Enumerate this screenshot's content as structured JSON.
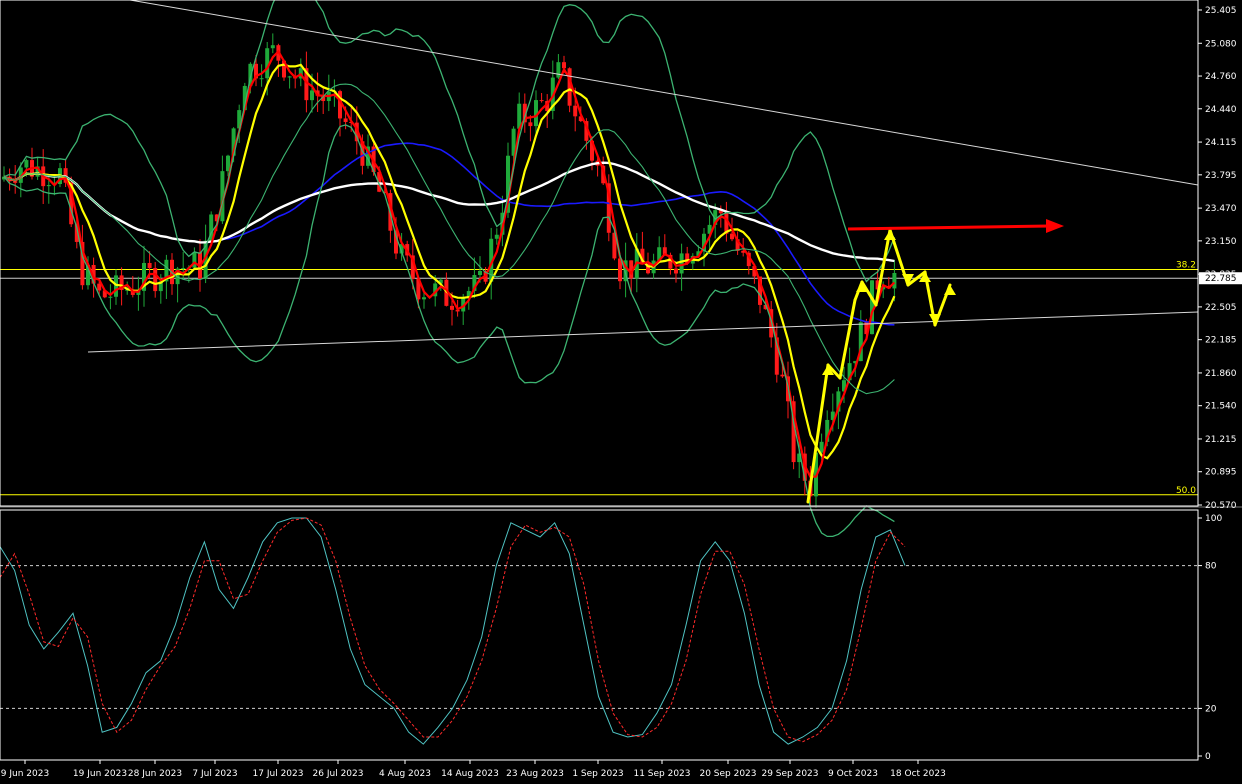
{
  "chart_data": [
    {
      "type": "candlestick",
      "title": "",
      "ylim": [
        20.57,
        25.405
      ],
      "y_ticks": [
        "25.405",
        "25.080",
        "24.760",
        "24.440",
        "24.115",
        "23.795",
        "23.470",
        "23.150",
        "22.825",
        "22.505",
        "22.185",
        "21.860",
        "21.540",
        "21.215",
        "20.895",
        "20.570"
      ],
      "x_ticks": [
        "9 Jun 2023",
        "19 Jun 2023",
        "28 Jun 2023",
        "7 Jul 2023",
        "17 Jul 2023",
        "26 Jul 2023",
        "4 Aug 2023",
        "14 Aug 2023",
        "23 Aug 2023",
        "1 Sep 2023",
        "11 Sep 2023",
        "20 Sep 2023",
        "29 Sep 2023",
        "9 Oct 2023",
        "18 Oct 2023"
      ],
      "current_price": "22.785",
      "fibonacci_levels": [
        {
          "label": "38.2",
          "value": 22.87
        },
        {
          "label": "50.0",
          "value": 20.67
        }
      ],
      "colors": {
        "bull_candle": "#1faa3a",
        "bear_candle": "#ff1a1a",
        "fast_ma": "#ff0000",
        "slow_ma": "#ffff00",
        "ma_blue": "#1a1aff",
        "ma_white": "#ffffff",
        "bollinger": "#3cb371",
        "trendline": "#d8d8d8",
        "fib_line": "#ffff00",
        "projection": "#ffff00",
        "target_arrow": "#ff0000"
      }
    },
    {
      "type": "line",
      "title": "",
      "ylim": [
        0,
        100
      ],
      "y_ticks": [
        "100",
        "80",
        "20",
        "0"
      ],
      "levels": [
        80,
        20
      ],
      "series": [
        {
          "color": "#4fc3c3",
          "values": [
            88,
            78,
            55,
            45,
            52,
            60,
            38,
            10,
            12,
            22,
            35,
            40,
            55,
            75,
            90,
            70,
            62,
            75,
            90,
            98,
            100,
            100,
            92,
            70,
            45,
            30,
            25,
            20,
            10,
            5,
            12,
            20,
            32,
            50,
            80,
            98,
            95,
            92,
            98,
            85,
            55,
            25,
            10,
            8,
            9,
            18,
            30,
            55,
            82,
            90,
            82,
            60,
            30,
            10,
            5,
            8,
            12,
            20,
            40,
            70,
            92,
            95,
            80
          ]
        },
        {
          "color": "#ff2a2a",
          "values": [
            75,
            85,
            68,
            48,
            46,
            58,
            50,
            22,
            10,
            15,
            28,
            38,
            46,
            62,
            82,
            82,
            66,
            68,
            82,
            94,
            99,
            100,
            97,
            82,
            58,
            38,
            28,
            22,
            15,
            8,
            8,
            15,
            25,
            40,
            62,
            88,
            97,
            94,
            96,
            92,
            72,
            40,
            18,
            9,
            8,
            12,
            22,
            40,
            68,
            86,
            86,
            72,
            45,
            20,
            8,
            6,
            9,
            15,
            28,
            54,
            82,
            94,
            88
          ]
        }
      ],
      "x_range": [
        0,
        62
      ]
    }
  ]
}
